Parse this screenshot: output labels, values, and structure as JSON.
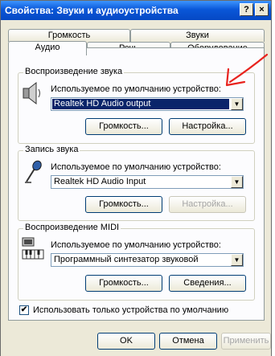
{
  "window": {
    "title": "Свойства: Звуки и аудиоустройства",
    "help_label": "?",
    "close_label": "×"
  },
  "tabs": {
    "row_back": [
      "Громкость",
      "Звуки"
    ],
    "row_front": [
      "Аудио",
      "Речь",
      "Оборудование"
    ],
    "active": "Аудио"
  },
  "playback": {
    "title": "Воспроизведение звука",
    "default_device_label": "Используемое по умолчанию устройство:",
    "device_value": "Realtek HD Audio output",
    "volume_button": "Громкость...",
    "settings_button": "Настройка..."
  },
  "recording": {
    "title": "Запись звука",
    "default_device_label": "Используемое по умолчанию устройство:",
    "device_value": "Realtek HD Audio Input",
    "volume_button": "Громкость...",
    "settings_button": "Настройка..."
  },
  "midi": {
    "title": "Воспроизведение MIDI",
    "default_device_label": "Используемое по умолчанию устройство:",
    "device_value": "Программный синтезатор звуковой",
    "volume_button": "Громкость...",
    "about_button": "Сведения..."
  },
  "use_default_only": {
    "label": "Использовать только устройства по умолчанию",
    "checked": true,
    "mark": "✔"
  },
  "footer": {
    "ok": "OK",
    "cancel": "Отмена",
    "apply": "Применить"
  },
  "colors": {
    "annotation_arrow": "#e8231e",
    "selection": "#0a246a"
  }
}
